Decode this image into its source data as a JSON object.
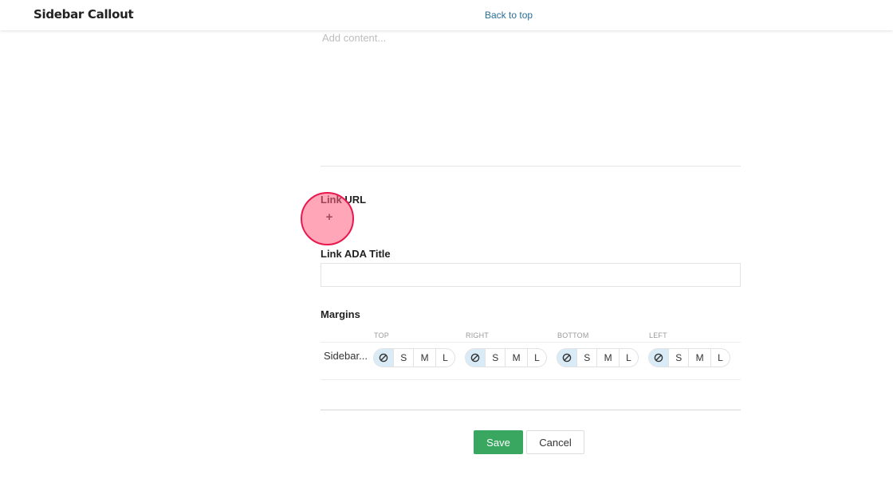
{
  "header": {
    "title": "Sidebar Callout",
    "back_to_top": "Back to top"
  },
  "editor": {
    "placeholder": "Add content..."
  },
  "fields": {
    "link_url_label": "Link URL",
    "add_icon_glyph": "+",
    "link_ada_title_label": "Link ADA Title",
    "link_ada_title_value": "",
    "margins_label": "Margins"
  },
  "margins": {
    "columns": [
      "TOP",
      "RIGHT",
      "BOTTOM",
      "LEFT"
    ],
    "row_label": "Sidebar...",
    "options": [
      "S",
      "M",
      "L"
    ],
    "selected": "none",
    "none_icon": "no-margin-icon"
  },
  "actions": {
    "save": "Save",
    "cancel": "Cancel"
  },
  "colors": {
    "save_bg": "#3aa760",
    "link": "#2a6f97",
    "selected_segment": "#d9ebf7",
    "click_marker": "#e8184d"
  }
}
